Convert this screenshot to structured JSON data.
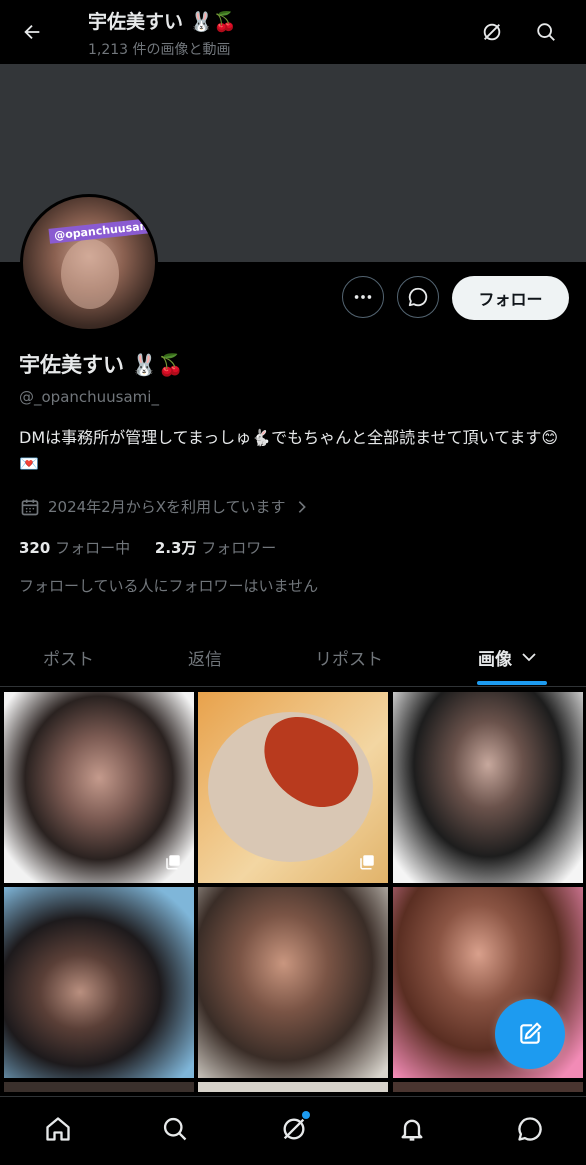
{
  "header": {
    "title": "宇佐美すい 🐰🍒",
    "subtitle": "1,213 件の画像と動画",
    "icons": [
      "back-arrow-icon",
      "grok-icon",
      "search-icon"
    ]
  },
  "profile": {
    "avatar_tag": "@opanchuusami",
    "name": "宇佐美すい 🐰🍒",
    "handle": "@_opanchuusami_",
    "bio": "DMは事務所が管理してまっしゅ🐇でもちゃんと全部読ませて頂いてます😊💌",
    "joined": "2024年2月からXを利用しています",
    "following_count": "320",
    "following_label": "フォロー中",
    "followers_count": "2.3万",
    "followers_label": "フォロワー",
    "followers_you_know": "フォローしている人にフォロワーはいません",
    "follow_button": "フォロー"
  },
  "tabs": [
    {
      "label": "ポスト"
    },
    {
      "label": "返信"
    },
    {
      "label": "リポスト"
    },
    {
      "label": "画像"
    }
  ],
  "media": [
    {
      "kind": "photo",
      "multi": true,
      "colors": [
        "#f2f2f2",
        "#2a2220",
        "#c49a8c"
      ]
    },
    {
      "kind": "food",
      "multi": true,
      "colors": [
        "#e8a24c",
        "#d9c7b4",
        "#b83a1e"
      ]
    },
    {
      "kind": "photo",
      "multi": false,
      "colors": [
        "#f5f5f5",
        "#1d1d1d",
        "#c7a89d"
      ]
    },
    {
      "kind": "photo",
      "multi": false,
      "colors": [
        "#7fb6d9",
        "#1d1a1c",
        "#b98f7f"
      ]
    },
    {
      "kind": "photo",
      "multi": false,
      "colors": [
        "#d8d4cc",
        "#3a2d27",
        "#c9967f"
      ]
    },
    {
      "kind": "photo",
      "multi": false,
      "colors": [
        "#5a2e22",
        "#f28bb6",
        "#d9a08c"
      ]
    }
  ],
  "bottom_nav": {
    "icons": [
      "home-icon",
      "search-icon",
      "grok-icon",
      "notifications-icon",
      "messages-icon"
    ]
  },
  "colors": {
    "accent": "#1d9bf0",
    "muted": "#71767b",
    "text": "#e7e9ea"
  }
}
